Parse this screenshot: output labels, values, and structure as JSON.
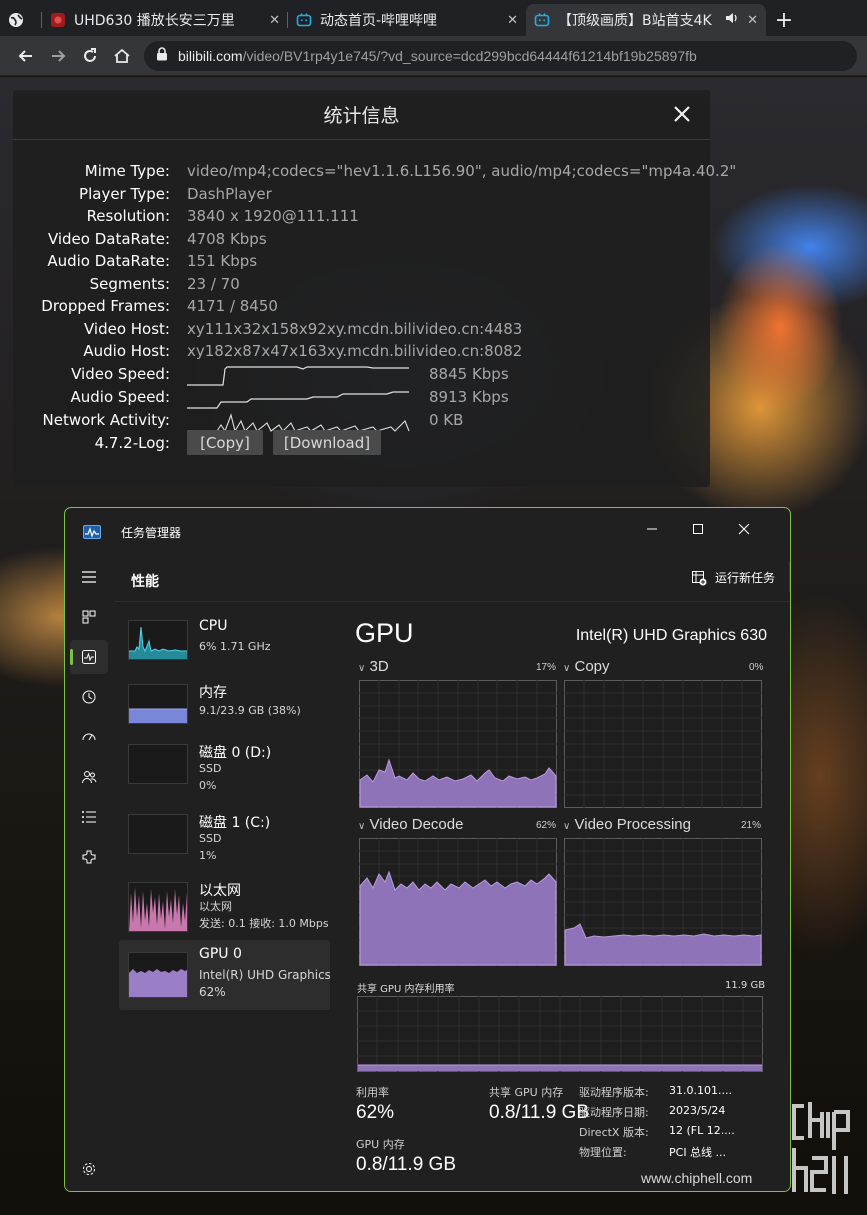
{
  "browser": {
    "tabs": [
      {
        "title": "UHD630 播放长安三万里",
        "icon": "chiphell-icon"
      },
      {
        "title": "动态首页-哔哩哔哩",
        "icon": "bilibili-icon"
      },
      {
        "title": "【顶级画质】B站首支4K",
        "icon": "bilibili-icon"
      }
    ],
    "url_host": "bilibili.com",
    "url_path": "/video/BV1rp4y1e745/?vd_source=dcd299bcd64444f61214bf19b25897fb"
  },
  "stats": {
    "title": "统计信息",
    "rows": [
      {
        "label": "Mime Type:",
        "value": "video/mp4;codecs=\"hev1.1.6.L156.90\", audio/mp4;codecs=\"mp4a.40.2\""
      },
      {
        "label": "Player Type:",
        "value": "DashPlayer"
      },
      {
        "label": "Resolution:",
        "value": "3840 x 1920@111.111"
      },
      {
        "label": "Video DataRate:",
        "value": "4708 Kbps"
      },
      {
        "label": "Audio DataRate:",
        "value": "151 Kbps"
      },
      {
        "label": "Segments:",
        "value": "23 / 70"
      },
      {
        "label": "Dropped Frames:",
        "value": "4171 / 8450"
      },
      {
        "label": "Video Host:",
        "value": "xy111x32x158x92xy.mcdn.bilivideo.cn:4483"
      },
      {
        "label": "Audio Host:",
        "value": "xy182x87x47x163xy.mcdn.bilivideo.cn:8082"
      }
    ],
    "graphs": [
      {
        "label": "Video Speed:",
        "value": "8845 Kbps"
      },
      {
        "label": "Audio Speed:",
        "value": "8913 Kbps"
      },
      {
        "label": "Network Activity:",
        "value": "0 KB"
      }
    ],
    "log_label": "4.7.2-Log:",
    "copy_label": "[Copy]",
    "download_label": "[Download]"
  },
  "taskmgr": {
    "title": "任务管理器",
    "page_title": "性能",
    "run_task": "运行新任务",
    "resources": [
      {
        "name": "CPU",
        "sub1": "6% 1.71 GHz",
        "sub2": ""
      },
      {
        "name": "内存",
        "sub1": "9.1/23.9 GB (38%)",
        "sub2": ""
      },
      {
        "name": "磁盘 0 (D:)",
        "sub1": "SSD",
        "sub2": "0%"
      },
      {
        "name": "磁盘 1 (C:)",
        "sub1": "SSD",
        "sub2": "1%"
      },
      {
        "name": "以太网",
        "sub1": "以太网",
        "sub2": "发送: 0.1 接收: 1.0 Mbps"
      },
      {
        "name": "GPU 0",
        "sub1": "Intel(R) UHD Graphics",
        "sub2": "62%"
      }
    ],
    "gpu": {
      "title": "GPU",
      "model": "Intel(R) UHD Graphics 630",
      "engines": [
        {
          "name": "3D",
          "pct": "17%"
        },
        {
          "name": "Copy",
          "pct": "0%"
        },
        {
          "name": "Video Decode",
          "pct": "62%"
        },
        {
          "name": "Video Processing",
          "pct": "21%"
        }
      ],
      "shared_mem_label": "共享 GPU 内存利用率",
      "shared_mem_max": "11.9 GB",
      "util_label": "利用率",
      "util_value": "62%",
      "shared_label": "共享 GPU 内存",
      "shared_value": "0.8/11.9 GB",
      "gpu_mem_label": "GPU 内存",
      "gpu_mem_value": "0.8/11.9 GB",
      "driver": [
        {
          "k": "驱动程序版本:",
          "v": "31.0.101...."
        },
        {
          "k": "驱动程序日期:",
          "v": "2023/5/24"
        },
        {
          "k": "DirectX 版本:",
          "v": "12 (FL 12...."
        },
        {
          "k": "物理位置:",
          "v": "PCI 总线 ..."
        }
      ]
    }
  },
  "watermark": {
    "url": "www.chiphell.com",
    "logo": "chiphell-logo"
  },
  "colors": {
    "accent": "#7bc142",
    "gpu_fill": "#9b7fc6",
    "cpu_fill": "#2aa6b8",
    "net_fill": "#e889c7",
    "mem_fill": "#7a86d8"
  }
}
